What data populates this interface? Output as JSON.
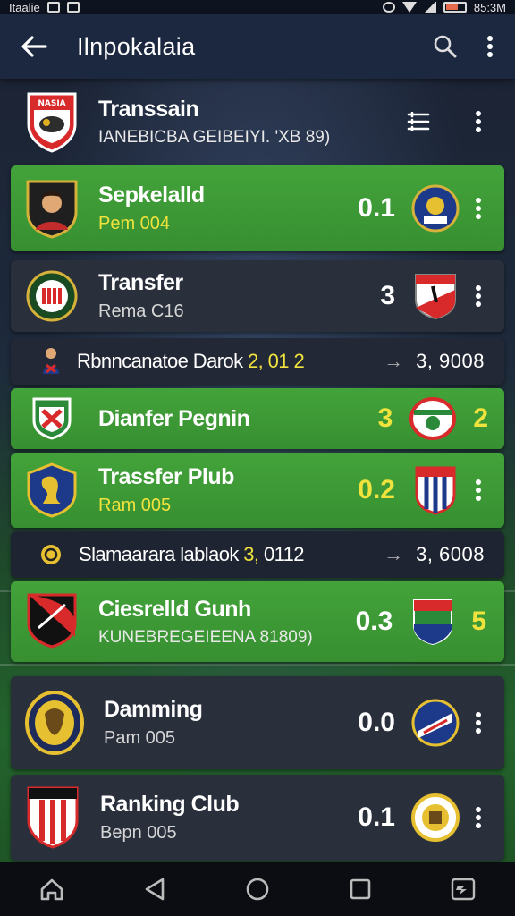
{
  "status_bar": {
    "left_text": "Itaalie",
    "right_text": "85:3M"
  },
  "app_bar": {
    "title": "Ilnpokalaia",
    "back_icon": "arrow-left-icon",
    "search_icon": "search-icon",
    "menu_icon": "more-vertical-icon"
  },
  "header": {
    "crest_label": "NASIA",
    "name": "Transsain",
    "subtitle": "IANEBICBA GEIBEIYI. 'XB 89)",
    "filter_icon": "list-filter-icon",
    "menu_icon": "more-vertical-icon"
  },
  "rows": [
    {
      "name": "Sepkelalld",
      "sub": "Pem 004",
      "score": "0.1"
    },
    {
      "name": "Transfer",
      "sub": "Rema C16",
      "score": "3"
    },
    {
      "slim_left": "Rbnncanatoe Darok",
      "slim_hl": "2, 01 2",
      "slim_right": "3, 9008"
    },
    {
      "name": "Dianfer Pegnin",
      "score": "3",
      "score2": "2"
    },
    {
      "name": "Trassfer Plub",
      "sub": "Ram 005",
      "score": "0.2"
    },
    {
      "slim_left": "Slamaarara lablaok",
      "slim_hl": "3,",
      "slim_mid": "0112",
      "slim_right": "3, 6008"
    },
    {
      "name": "Ciesrelld Gunh",
      "sub": "KUNEBREGEIEENA 81809)",
      "score": "0.3",
      "score2": "5"
    },
    {
      "name": "Damming",
      "sub": "Pam 005",
      "score": "0.0"
    },
    {
      "name": "Ranking Club",
      "sub": "Bepn 005",
      "score": "0.1"
    }
  ],
  "colors": {
    "accent_green": "#43a33a",
    "highlight_yellow": "#f0e33d",
    "row_dark": "#2a2f3c",
    "app_bar": "#1c2740"
  },
  "nav": {
    "home_icon": "home-icon",
    "back_icon": "nav-back-icon",
    "home_circle_icon": "circle-home-icon",
    "recents_icon": "recents-icon",
    "assist_icon": "screenshot-icon"
  }
}
